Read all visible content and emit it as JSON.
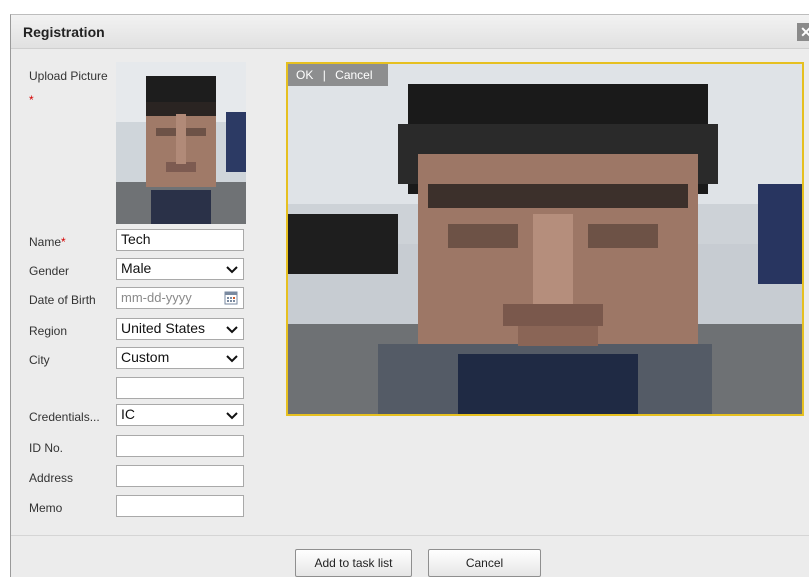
{
  "dialog": {
    "title": "Registration"
  },
  "form": {
    "upload_label": "Upload Picture",
    "upload_required_mark": "*",
    "name_label": "Name",
    "name_required_mark": "*",
    "name_value": "Tech",
    "gender_label": "Gender",
    "gender_value": "Male",
    "dob_label": "Date of Birth",
    "dob_placeholder": "mm-dd-yyyy",
    "region_label": "Region",
    "region_value": "United States",
    "city_label": "City",
    "city_value": "Custom",
    "city_custom_value": "",
    "credentials_label": "Credentials...",
    "credentials_value": "IC",
    "id_label": "ID No.",
    "id_value": "",
    "address_label": "Address",
    "address_value": "",
    "memo_label": "Memo",
    "memo_value": ""
  },
  "image_editor": {
    "ok_label": "OK",
    "separator": "|",
    "cancel_label": "Cancel"
  },
  "footer": {
    "add_label": "Add to task list",
    "cancel_label": "Cancel"
  },
  "colors": {
    "crop_border": "#e6c020",
    "required": "#d40000"
  },
  "icons": [
    "close-icon",
    "chevron-down-icon",
    "calendar-icon"
  ]
}
